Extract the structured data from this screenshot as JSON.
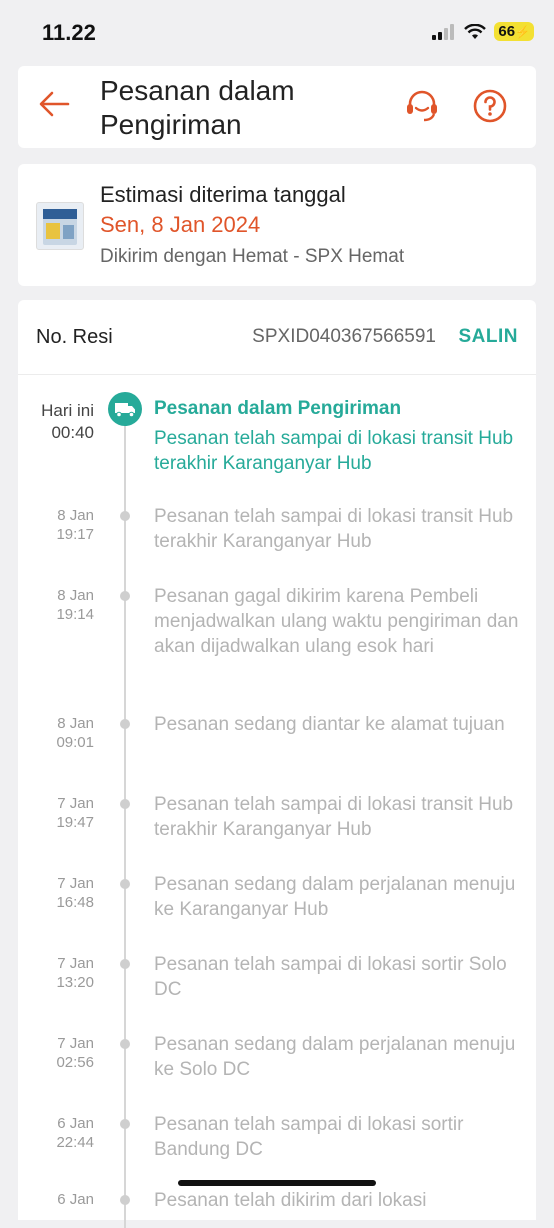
{
  "status_bar": {
    "time": "11.22",
    "battery": "66"
  },
  "header": {
    "title": "Pesanan dalam Pengiriman"
  },
  "estimate": {
    "label": "Estimasi diterima tanggal",
    "date": "Sen, 8 Jan 2024",
    "shipping": "Dikirim dengan Hemat - SPX Hemat"
  },
  "tracking": {
    "resi_label": "No. Resi",
    "resi_value": "SPXID040367566591",
    "copy_label": "SALIN",
    "current": {
      "date": "Hari ini",
      "time": "00:40",
      "title": "Pesanan dalam Pengiriman",
      "text": "Pesanan telah sampai di lokasi transit Hub terakhir Karanganyar Hub"
    },
    "events": [
      {
        "date": "8 Jan",
        "time": "19:17",
        "text": "Pesanan telah sampai di lokasi transit Hub terakhir Karanganyar Hub"
      },
      {
        "date": "8 Jan",
        "time": "19:14",
        "text": "Pesanan gagal dikirim karena Pembeli menjadwalkan ulang waktu pengiriman dan akan dijadwalkan ulang esok hari"
      },
      {
        "date": "8 Jan",
        "time": "09:01",
        "text": "Pesanan sedang diantar ke alamat tujuan"
      },
      {
        "date": "7 Jan",
        "time": "19:47",
        "text": "Pesanan telah sampai di lokasi transit Hub terakhir Karanganyar Hub"
      },
      {
        "date": "7 Jan",
        "time": "16:48",
        "text": "Pesanan sedang dalam perjalanan menuju ke Karanganyar Hub"
      },
      {
        "date": "7 Jan",
        "time": "13:20",
        "text": "Pesanan telah sampai di lokasi sortir Solo DC"
      },
      {
        "date": "7 Jan",
        "time": "02:56",
        "text": "Pesanan sedang dalam perjalanan menuju ke Solo DC"
      },
      {
        "date": "6 Jan",
        "time": "22:44",
        "text": "Pesanan telah sampai di lokasi sortir Bandung DC"
      },
      {
        "date": "6 Jan",
        "time": "",
        "text": "Pesanan telah dikirim dari lokasi"
      }
    ]
  },
  "icons": {
    "back": "arrow-left-icon",
    "support": "headset-icon",
    "help": "question-circle-icon",
    "truck": "truck-icon"
  },
  "colors": {
    "accent": "#e0552a",
    "teal": "#26aa99"
  }
}
